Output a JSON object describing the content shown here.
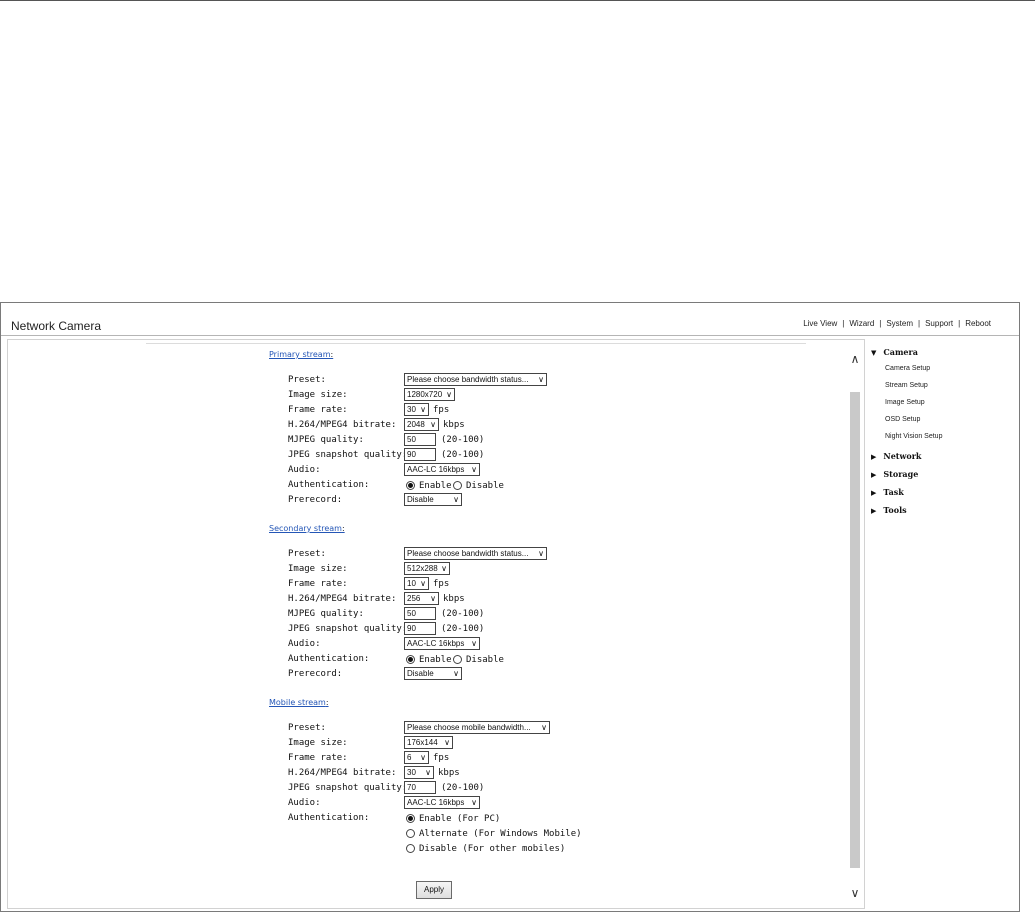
{
  "header": {
    "title": "Network Camera",
    "nav": [
      "Live View",
      "Wizard",
      "System",
      "Support",
      "Reboot"
    ],
    "separator": "|"
  },
  "primary": {
    "heading": "Primary stream",
    "labels": {
      "preset": "Preset:",
      "image_size": "Image size:",
      "frame_rate": "Frame rate:",
      "bitrate": "H.264/MPEG4 bitrate:",
      "mjpeg": "MJPEG quality:",
      "jpeg": "JPEG snapshot quality:",
      "audio": "Audio:",
      "auth": "Authentication:",
      "prerecord": "Prerecord:"
    },
    "preset": "Please choose bandwidth status...",
    "image_size": "1280x720",
    "frame_rate": "30",
    "bitrate": "2048",
    "mjpeg_quality": "50",
    "jpeg_quality": "90",
    "audio": "AAC-LC 16kbps",
    "auth_enable": "Enable",
    "auth_disable": "Disable",
    "prerecord": "Disable"
  },
  "secondary": {
    "heading": "Secondary stream",
    "preset": "Please choose bandwidth status...",
    "image_size": "512x288",
    "frame_rate": "10",
    "bitrate": "256",
    "mjpeg_quality": "50",
    "jpeg_quality": "90",
    "audio": "AAC-LC 16kbps",
    "auth_enable": "Enable",
    "auth_disable": "Disable",
    "prerecord": "Disable"
  },
  "mobile": {
    "heading": "Mobile stream",
    "preset": "Please choose mobile bandwidth...",
    "image_size": "176x144",
    "frame_rate": "6",
    "bitrate": "30",
    "jpeg_quality": "70",
    "audio": "AAC-LC 16kbps",
    "auth_options": [
      "Enable (For PC)",
      "Alternate (For Windows Mobile)",
      "Disable (For other mobiles)"
    ]
  },
  "units": {
    "fps": "fps",
    "kbps": "kbps",
    "range": "(20-100)",
    "colon": ":"
  },
  "apply_label": "Apply",
  "sidebar": {
    "camera": "Camera",
    "camera_items": [
      "Camera Setup",
      "Stream Setup",
      "Image Setup",
      "OSD Setup",
      "Night Vision Setup"
    ],
    "network": "Network",
    "storage": "Storage",
    "task": "Task",
    "tools": "Tools"
  }
}
